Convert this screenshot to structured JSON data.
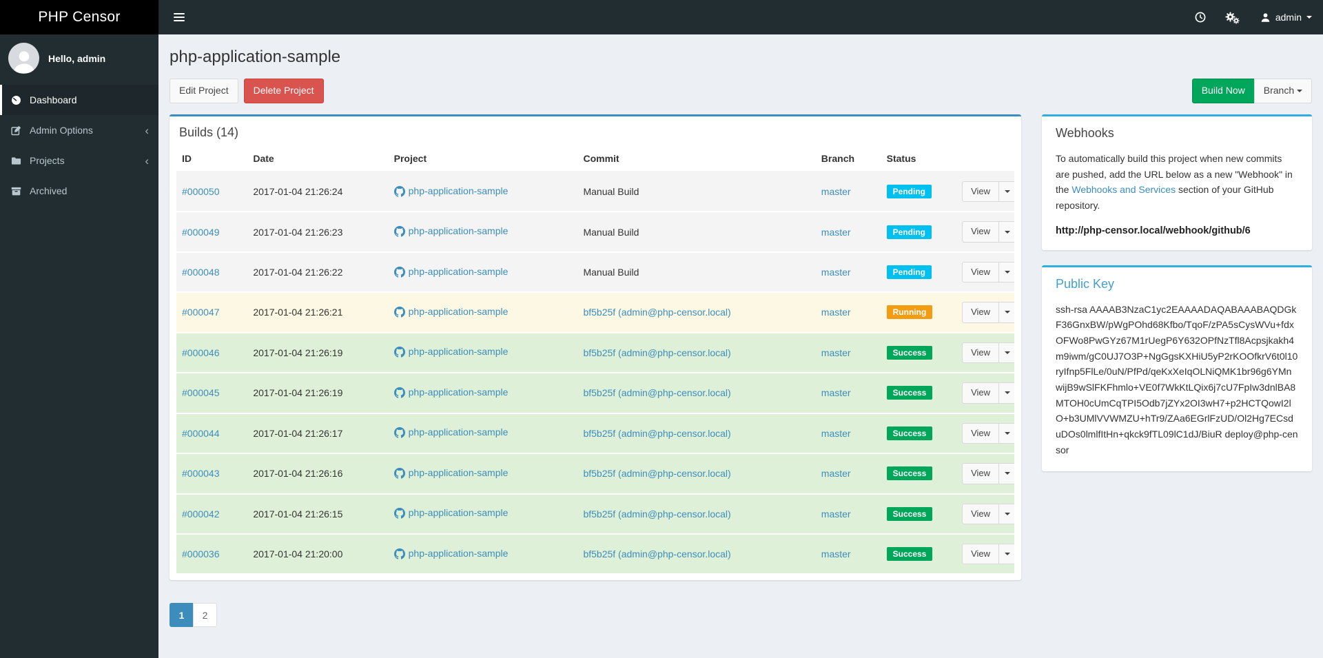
{
  "app": {
    "logo": "PHP Censor"
  },
  "navbar": {
    "user_label": "admin",
    "icons": [
      "hamburger",
      "clock",
      "cogs",
      "user",
      "caret-down"
    ]
  },
  "sidebar": {
    "greeting": "Hello, admin",
    "items": [
      {
        "label": "Dashboard",
        "icon": "dashboard-gauge",
        "active": true,
        "has_children": false
      },
      {
        "label": "Admin Options",
        "icon": "edit-pencil",
        "active": false,
        "has_children": true
      },
      {
        "label": "Projects",
        "icon": "folder",
        "active": false,
        "has_children": true
      },
      {
        "label": "Archived",
        "icon": "archive-box",
        "active": false,
        "has_children": false
      }
    ]
  },
  "page": {
    "title": "php-application-sample",
    "edit_label": "Edit Project",
    "delete_label": "Delete Project",
    "build_now_label": "Build Now",
    "branch_label": "Branch"
  },
  "builds_panel": {
    "title": "Builds (14)",
    "columns": [
      "ID",
      "Date",
      "Project",
      "Commit",
      "Branch",
      "Status",
      ""
    ],
    "view_label": "View",
    "rows": [
      {
        "id": "#000050",
        "date": "2017-01-04 21:26:24",
        "project": "php-application-sample",
        "commit": "Manual Build",
        "commit_is_link": false,
        "branch": "master",
        "status": "Pending",
        "status_type": "pending"
      },
      {
        "id": "#000049",
        "date": "2017-01-04 21:26:23",
        "project": "php-application-sample",
        "commit": "Manual Build",
        "commit_is_link": false,
        "branch": "master",
        "status": "Pending",
        "status_type": "pending"
      },
      {
        "id": "#000048",
        "date": "2017-01-04 21:26:22",
        "project": "php-application-sample",
        "commit": "Manual Build",
        "commit_is_link": false,
        "branch": "master",
        "status": "Pending",
        "status_type": "pending"
      },
      {
        "id": "#000047",
        "date": "2017-01-04 21:26:21",
        "project": "php-application-sample",
        "commit": "bf5b25f (admin@php-censor.local)",
        "commit_is_link": true,
        "branch": "master",
        "status": "Running",
        "status_type": "running"
      },
      {
        "id": "#000046",
        "date": "2017-01-04 21:26:19",
        "project": "php-application-sample",
        "commit": "bf5b25f (admin@php-censor.local)",
        "commit_is_link": true,
        "branch": "master",
        "status": "Success",
        "status_type": "success"
      },
      {
        "id": "#000045",
        "date": "2017-01-04 21:26:19",
        "project": "php-application-sample",
        "commit": "bf5b25f (admin@php-censor.local)",
        "commit_is_link": true,
        "branch": "master",
        "status": "Success",
        "status_type": "success"
      },
      {
        "id": "#000044",
        "date": "2017-01-04 21:26:17",
        "project": "php-application-sample",
        "commit": "bf5b25f (admin@php-censor.local)",
        "commit_is_link": true,
        "branch": "master",
        "status": "Success",
        "status_type": "success"
      },
      {
        "id": "#000043",
        "date": "2017-01-04 21:26:16",
        "project": "php-application-sample",
        "commit": "bf5b25f (admin@php-censor.local)",
        "commit_is_link": true,
        "branch": "master",
        "status": "Success",
        "status_type": "success"
      },
      {
        "id": "#000042",
        "date": "2017-01-04 21:26:15",
        "project": "php-application-sample",
        "commit": "bf5b25f (admin@php-censor.local)",
        "commit_is_link": true,
        "branch": "master",
        "status": "Success",
        "status_type": "success"
      },
      {
        "id": "#000036",
        "date": "2017-01-04 21:20:00",
        "project": "php-application-sample",
        "commit": "bf5b25f (admin@php-censor.local)",
        "commit_is_link": true,
        "branch": "master",
        "status": "Success",
        "status_type": "success"
      }
    ],
    "pagination": [
      {
        "label": "1",
        "active": true
      },
      {
        "label": "2",
        "active": false
      }
    ]
  },
  "webhooks": {
    "title": "Webhooks",
    "text_before": "To automatically build this project when new commits are pushed, add the URL below as a new \"Webhook\" in the ",
    "link_label": "Webhooks and Services",
    "text_after": " section of your GitHub repository.",
    "url": "http://php-censor.local/webhook/github/6"
  },
  "public_key": {
    "title": "Public Key",
    "key": "ssh-rsa AAAAB3NzaC1yc2EAAAADAQABAAABAQDGkF36GnxBW/pWgPOhd68Kfbo/TqoF/zPA5sCysWVu+fdxOFWo8PwGYz67M1rUegP6Y632OPfNzTfl8Acpsjkakh4m9iwm/gC0UJ7O3P+NgGgsKXHiU5yP2rKOOfkrV6t0l10ryIfnp5FlLe/0uN/PfPd/qeKxXeIqOLNiQMK1br96g6YMnwijB9wSlFKFhmlo+VE0f7WkKtLQix6j7cU7FpIw3dnlBA8MTOH0cUmCqTPI5Odb7jZYx2OI3wH7+p2HCTQowI2lO+b3UMlVVWMZU+hTr9/ZAa6EGrlFzUD/Ol2Hg7ECsduDOs0lmlfItHn+qkck9fTL09lC1dJ/BiuR deploy@php-censor"
  },
  "colors": {
    "accent_blue": "#3c8dbc",
    "status_pending": "#00c0ef",
    "status_running": "#f39c12",
    "status_success": "#00a65a",
    "danger_red": "#d9534f",
    "build_now_green": "#00a65a",
    "navbar_bg": "#222d32",
    "logo_bg": "#000000",
    "sidebar_active_bg": "#1e282c",
    "sidebar_text": "#b8c7ce",
    "body_bg": "#ecf0f5",
    "row_pending_bg": "#f4f4f4",
    "row_running_bg": "#fcf8e3",
    "row_success_bg": "#dff0d8"
  }
}
